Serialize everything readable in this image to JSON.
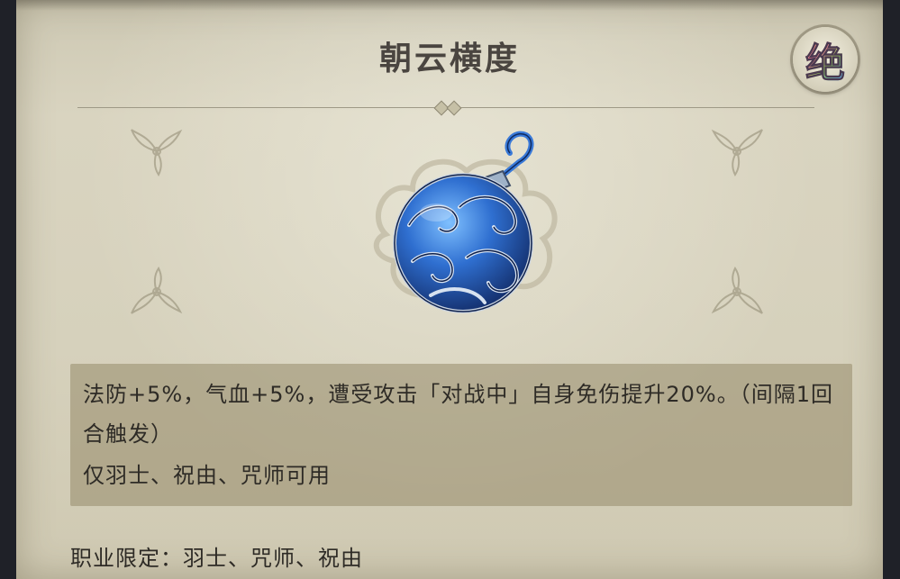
{
  "item": {
    "name": "朝云横度",
    "grade": "绝",
    "icon": "blue-cloud-orb-pendant"
  },
  "description": {
    "effect": "法防+5%，气血+5%，遭受攻击「对战中」自身免伤提升20%。（间隔1回合触发）",
    "restriction": "仅羽士、祝由、咒师可用"
  },
  "job_limit": {
    "label": "职业限定：",
    "classes": "羽士、咒师、祝由"
  },
  "colors": {
    "parchment": "#d6d1bc",
    "desc_box": "#968a69",
    "title": "#4a4540",
    "text": "#2e2b26",
    "orb_blue": "#2f6fd0"
  }
}
